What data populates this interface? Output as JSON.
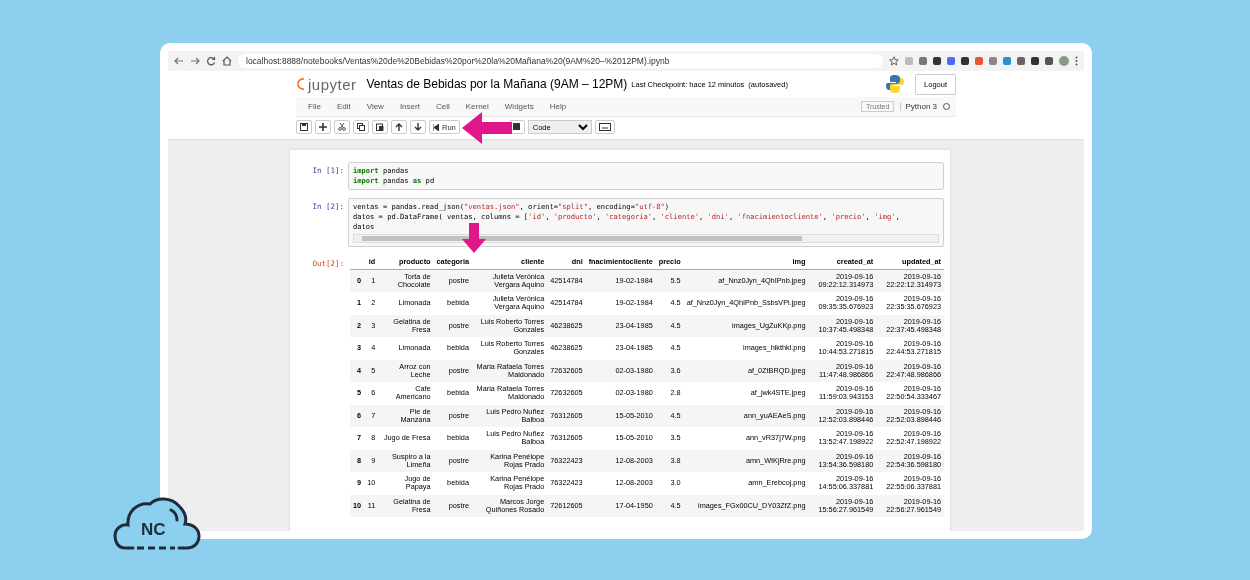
{
  "browser": {
    "url": "localhost:8888/notebooks/Ventas%20de%20Bebidas%20por%20la%20Mañana%20(9AM%20–%2012PM).ipynb"
  },
  "header": {
    "logo": "jupyter",
    "title": "Ventas de Bebidas por la Mañana (9AM – 12PM)",
    "checkpoint": "Last Checkpoint: hace 12 minutos",
    "autosave": "(autosaved)",
    "logout": "Logout"
  },
  "menu": {
    "items": [
      "File",
      "Edit",
      "View",
      "Insert",
      "Cell",
      "Kernel",
      "Widgets",
      "Help"
    ],
    "trusted": "Trusted",
    "kernel": "Python 3"
  },
  "toolbar": {
    "run": "Run",
    "cell_type": "Code"
  },
  "cells": [
    {
      "prompt": "In [1]:",
      "lines": [
        [
          {
            "text": "import",
            "kind": "kw"
          },
          {
            "text": " pandas",
            "kind": "plain"
          }
        ],
        [
          {
            "text": "import",
            "kind": "kw"
          },
          {
            "text": " pandas ",
            "kind": "plain"
          },
          {
            "text": "as",
            "kind": "kw"
          },
          {
            "text": " pd",
            "kind": "plain"
          }
        ]
      ]
    },
    {
      "prompt": "In [2]:",
      "lines": [
        [
          {
            "text": "ventas = pandas.read_json(",
            "kind": "plain"
          },
          {
            "text": "\"ventas.json\"",
            "kind": "str"
          },
          {
            "text": ", orient=",
            "kind": "plain"
          },
          {
            "text": "\"split\"",
            "kind": "str"
          },
          {
            "text": ", encoding=",
            "kind": "plain"
          },
          {
            "text": "\"utf-8\"",
            "kind": "str"
          },
          {
            "text": ")",
            "kind": "plain"
          }
        ],
        [
          {
            "text": "datos = pd.DataFrame( ventas, columns = [",
            "kind": "plain"
          },
          {
            "text": "'id'",
            "kind": "str"
          },
          {
            "text": ", ",
            "kind": "plain"
          },
          {
            "text": "'producto'",
            "kind": "str"
          },
          {
            "text": ", ",
            "kind": "plain"
          },
          {
            "text": "'categoria'",
            "kind": "str"
          },
          {
            "text": ", ",
            "kind": "plain"
          },
          {
            "text": "'cliente'",
            "kind": "str"
          },
          {
            "text": ", ",
            "kind": "plain"
          },
          {
            "text": "'dni'",
            "kind": "str"
          },
          {
            "text": ", ",
            "kind": "plain"
          },
          {
            "text": "'fnacimientocliente'",
            "kind": "str"
          },
          {
            "text": ", ",
            "kind": "plain"
          },
          {
            "text": "'precio'",
            "kind": "str"
          },
          {
            "text": ", ",
            "kind": "plain"
          },
          {
            "text": "'img'",
            "kind": "str"
          },
          {
            "text": ",",
            "kind": "plain"
          }
        ],
        [
          {
            "text": "datos",
            "kind": "plain"
          }
        ]
      ]
    }
  ],
  "output": {
    "prompt": "Out[2]:",
    "columns": [
      "",
      "id",
      "producto",
      "categoria",
      "cliente",
      "dni",
      "fnacimientocliente",
      "precio",
      "img",
      "created_at",
      "updated_at"
    ],
    "rows": [
      [
        "0",
        "1",
        "Torta de Chocolate",
        "postre",
        "Julieta Verónica Vergara Aquino",
        "42514784",
        "19-02-1984",
        "5.5",
        "af_Nnz0Jyn_4QhIPnb.jpeg",
        "2019-09-16 09:22:12.314973",
        "2019-09-16 22:22:12.314973"
      ],
      [
        "1",
        "2",
        "Limonada",
        "bebida",
        "Julieta Verónica Vergara Aquino",
        "42514784",
        "19-02-1984",
        "4.5",
        "af_Nnz0Jyn_4QhIPnb_SsbsVPi.jpeg",
        "2019-09-16 09:35:35.676923",
        "2019-09-16 22:35:35.676923"
      ],
      [
        "2",
        "3",
        "Gelatina de Fresa",
        "postre",
        "Luis Roberto Torres Gonzales",
        "46238625",
        "23-04-1985",
        "4.5",
        "images_UgZuKKp.png",
        "2019-09-16 10:37:45.498348",
        "2019-09-16 22:37:45.498348"
      ],
      [
        "3",
        "4",
        "Limonada",
        "bebida",
        "Luis Roberto Torres Gonzales",
        "46238625",
        "23-04-1985",
        "4.5",
        "images_hlkthkl.png",
        "2019-09-16 10:44:53.271815",
        "2019-09-16 22:44:53.271815"
      ],
      [
        "4",
        "5",
        "Arroz con Leche",
        "postre",
        "Maria Rafaela Torres Maldonado",
        "72632605",
        "02-03-1980",
        "3.6",
        "af_0ZtBRQD.jpeg",
        "2019-09-16 11:47:48.986866",
        "2019-09-16 22:47:48.986866"
      ],
      [
        "5",
        "6",
        "Cafe Americano",
        "bebida",
        "Maria Rafaela Torres Maldonado",
        "72632605",
        "02-03-1980",
        "2.8",
        "af_jwk4STE.jpeg",
        "2019-09-16 11:59:03.943153",
        "2019-09-16 22:50:54.333467"
      ],
      [
        "6",
        "7",
        "Pie de Manzana",
        "postre",
        "Luis Pedro Nuñez Balboa",
        "76312605",
        "15-05-2010",
        "4.5",
        "ann_yuAEAeS.png",
        "2019-09-16 12:52:03.898446",
        "2019-09-16 22:52:03.898446"
      ],
      [
        "7",
        "8",
        "Jugo de Fresa",
        "bebida",
        "Luis Pedro Nuñez Balboa",
        "76312605",
        "15-05-2010",
        "3.5",
        "ann_vR37j7W.png",
        "2019-09-16 13:52:47.198922",
        "2019-09-16 22:52:47.198922"
      ],
      [
        "8",
        "9",
        "Suspiro a la Limeña",
        "postre",
        "Karina Penélope Rojas Prado",
        "76322423",
        "12-08-2003",
        "3.8",
        "amn_WIKjRre.png",
        "2019-09-16 13:54:36.598180",
        "2019-09-16 22:54:36.598180"
      ],
      [
        "9",
        "10",
        "Jugo de Papaya",
        "bebida",
        "Karina Penélope Rojas Prado",
        "76322423",
        "12-08-2003",
        "3.0",
        "amn_Erebcoj.png",
        "2019-09-16 14:55:06.337881",
        "2019-09-16 22:55:06.337881"
      ],
      [
        "10",
        "11",
        "Gelatina de Fresa",
        "postre",
        "Marcos Jorge Quiñones Rosado",
        "72612605",
        "17-04-1950",
        "4.5",
        "images_FGx00CU_DY03ZfZ.png",
        "2019-09-16 15:56:27.961549",
        "2019-09-16 22:56:27.961549"
      ]
    ]
  },
  "brand": {
    "logo": "NC"
  }
}
